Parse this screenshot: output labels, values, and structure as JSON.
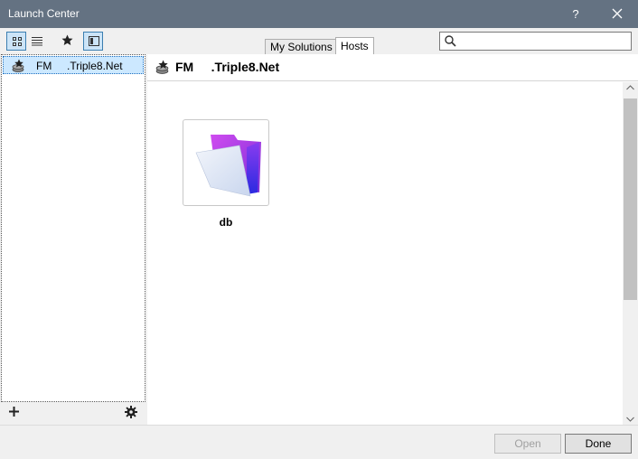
{
  "window": {
    "title": "Launch Center",
    "help_label": "?",
    "close_icon": "close-icon"
  },
  "toolbar": {
    "icons": [
      "grid-view-icon",
      "list-view-icon",
      "star-icon",
      "sidebar-toggle-icon"
    ]
  },
  "tabs": [
    {
      "label": "My Solutions",
      "selected": false
    },
    {
      "label": "Hosts",
      "selected": true
    }
  ],
  "search": {
    "value": "",
    "placeholder": "",
    "icon": "search-icon"
  },
  "sidebar": {
    "hosts": [
      {
        "name": "FM     .Triple8.Net",
        "selected": true,
        "icon": "host-star-icon"
      }
    ],
    "footer_icons": [
      "add-icon",
      "gear-icon"
    ]
  },
  "content": {
    "host_name": "FM     .Triple8.Net",
    "files": [
      {
        "name": "db",
        "icon": "filemaker-folder-icon"
      }
    ]
  },
  "footer": {
    "open_label": "Open",
    "done_label": "Done",
    "open_enabled": false
  },
  "colors": {
    "titlebar": "#647282",
    "selection": "#cce8ff",
    "accent": "#3c7fb1"
  }
}
